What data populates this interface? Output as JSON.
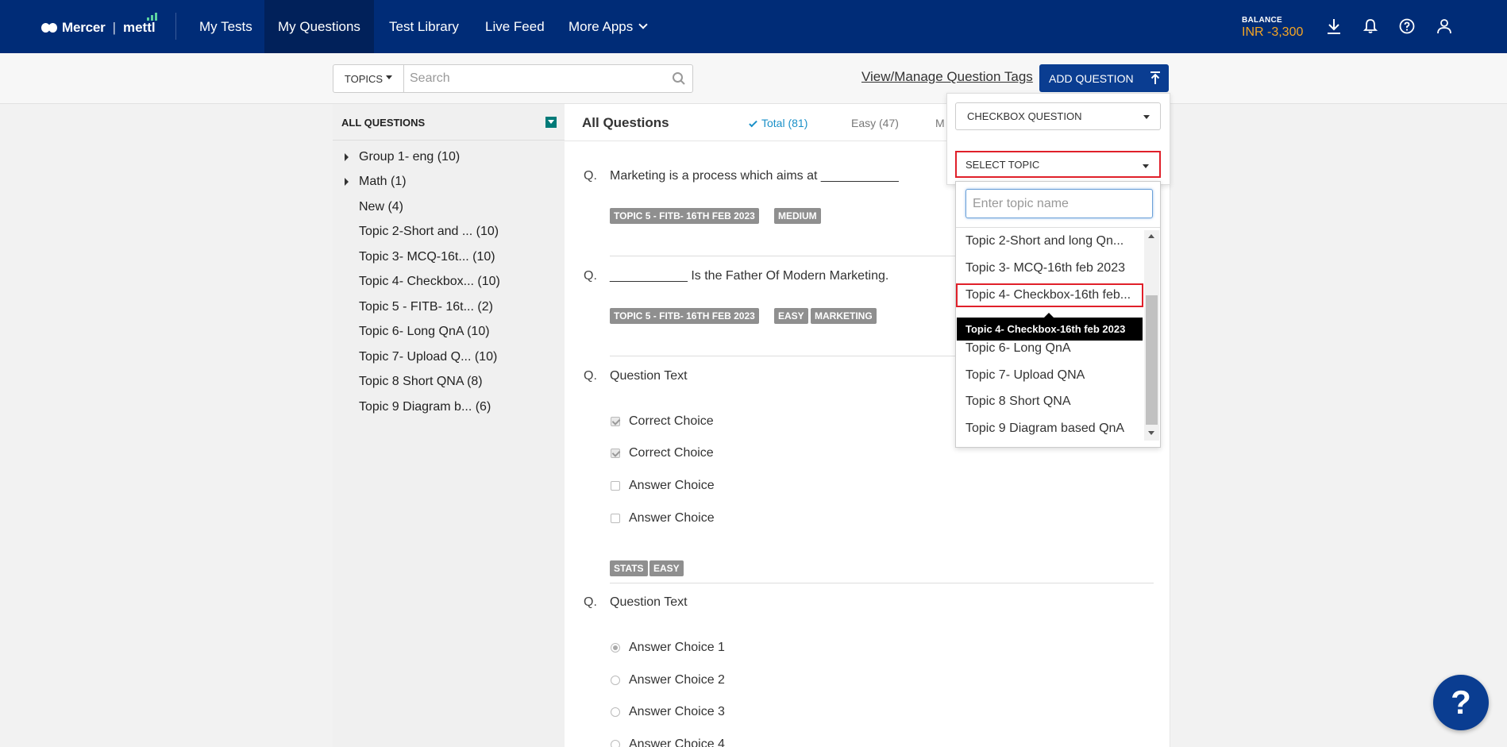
{
  "header": {
    "logo_brand": "Mercer",
    "logo_separator": "|",
    "logo_brand2": "mettl",
    "nav": [
      {
        "label": "My Tests"
      },
      {
        "label": "My Questions",
        "active": true
      },
      {
        "label": "Test Library"
      },
      {
        "label": "Live Feed"
      },
      {
        "label": "More Apps"
      }
    ],
    "balance_label": "BALANCE",
    "balance_value": "INR -3,300",
    "icons": [
      "download-icon",
      "bell-icon",
      "help-icon",
      "user-icon"
    ]
  },
  "toolbar": {
    "topics_label": "TOPICS",
    "search_placeholder": "Search",
    "tags_link": "View/Manage Question Tags",
    "add_question_label": "ADD QUESTION"
  },
  "sidebar": {
    "title": "ALL QUESTIONS",
    "items": [
      {
        "label": "Group 1- eng (10)",
        "expandable": true
      },
      {
        "label": "Math (1)",
        "expandable": true
      },
      {
        "label": "New (4)"
      },
      {
        "label": "Topic 2-Short and ...  (10)"
      },
      {
        "label": "Topic 3- MCQ-16t...   (10)"
      },
      {
        "label": "Topic 4- Checkbox... (10)"
      },
      {
        "label": "Topic 5 - FITB- 16t...  (2)"
      },
      {
        "label": "Topic 6- Long QnA (10)"
      },
      {
        "label": "Topic 7- Upload Q...  (10)"
      },
      {
        "label": "Topic 8 Short QNA (8)"
      },
      {
        "label": "Topic 9 Diagram b...  (6)"
      }
    ]
  },
  "main": {
    "title": "All Questions",
    "filters": {
      "total": "Total (81)",
      "easy": "Easy (47)",
      "more": "M"
    },
    "questions": [
      {
        "q": "Q.",
        "text": "Marketing is a process which aims at  ___________",
        "badges": [
          "TOPIC 5 - FITB- 16TH FEB 2023",
          "MEDIUM"
        ]
      },
      {
        "q": "Q.",
        "text": "___________ Is the Father Of Modern Marketing.",
        "badges": [
          "TOPIC 5 - FITB- 16TH FEB 2023",
          "EASY",
          "MARKETING"
        ]
      },
      {
        "q": "Q.",
        "text": "Question Text",
        "choices": [
          "Correct Choice",
          "Correct Choice",
          "Answer Choice",
          "Answer Choice"
        ],
        "badges": [
          "STATS",
          "EASY"
        ]
      },
      {
        "q": "Q.",
        "text": "Question Text",
        "choices": [
          "Answer Choice 1",
          "Answer Choice 2",
          "Answer Choice 3",
          "Answer Choice 4"
        ]
      }
    ]
  },
  "add_panel": {
    "question_type": "CHECKBOX QUESTION",
    "topic_select": "SELECT TOPIC",
    "topic_search_placeholder": "Enter topic name",
    "topics": [
      "Topic 2-Short and long Qn...",
      "Topic 3- MCQ-16th feb 2023",
      "Topic 4- Checkbox-16th feb...",
      "Topic 6- Long QnA",
      "Topic 7- Upload QNA",
      "Topic 8 Short QNA",
      "Topic 9 Diagram based QnA"
    ],
    "tooltip": "Topic 4- Checkbox-16th feb 2023"
  },
  "help_fab": "?"
}
